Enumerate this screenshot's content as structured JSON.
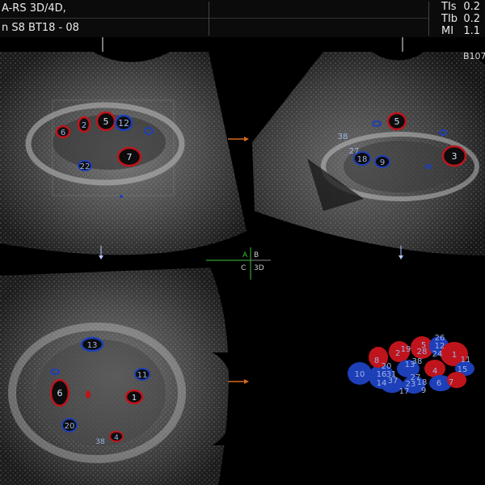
{
  "header": {
    "mode_line": "A-RS 3D/4D,",
    "probe_line": "n S8 BT18 - 08",
    "indices": [
      {
        "key": "TIs",
        "value": "0.2"
      },
      {
        "key": "TIb",
        "value": "0.2"
      },
      {
        "key": "MI",
        "value": "1.1"
      }
    ]
  },
  "panels": {
    "quad_b_label": "B107",
    "crosshair": {
      "a": "A",
      "b": "B",
      "c": "C",
      "d": "3D"
    }
  },
  "follicles": {
    "plane_a": [
      "6",
      "2",
      "5",
      "12",
      "7",
      "22"
    ],
    "plane_b": [
      "5",
      "38",
      "27",
      "18",
      "9",
      "3"
    ],
    "plane_c": [
      "13",
      "11",
      "6",
      "1",
      "20",
      "4",
      "38"
    ],
    "render_3d": [
      "26",
      "12",
      "19",
      "5",
      "28",
      "2",
      "24",
      "1",
      "11",
      "8",
      "13",
      "38",
      "15",
      "20",
      "4",
      "10",
      "16",
      "31",
      "27",
      "37",
      "14",
      "23",
      "18",
      "6",
      "7",
      "17",
      "9"
    ]
  },
  "colors": {
    "follicle_red": "#c0141c",
    "follicle_blue": "#1d3fb8",
    "label": "#9fb4e6",
    "arrow": "#d46a1a",
    "axis_green": "#3fbf3f"
  }
}
